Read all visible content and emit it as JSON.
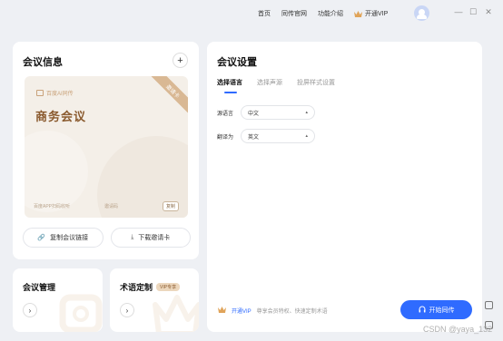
{
  "titlebar": {
    "nav": [
      "首页",
      "同传官网",
      "功能介绍"
    ],
    "vip_label": "开通VIP",
    "window_controls": [
      "—",
      "☐",
      "✕"
    ]
  },
  "left": {
    "title": "会议信息",
    "plus": "+",
    "brand": "百度AI同传",
    "meeting_name": "商务会议",
    "ribbon": "邀请卡",
    "scan_hint": "百度APP扫码收听",
    "invite_code": "邀请码",
    "copy_mini": "复制",
    "copy_link": "复制会议链接",
    "download_card": "下载邀请卡"
  },
  "cards": {
    "manage_title": "会议管理",
    "term_title": "术语定制",
    "term_badge": "VIP专享",
    "arrow": "›"
  },
  "right": {
    "title": "会议设置",
    "tabs": [
      "选择语言",
      "选择声源",
      "投屏样式设置"
    ],
    "source_label": "源语言",
    "source_value": "中文",
    "target_label": "翻译为",
    "target_value": "英文",
    "vip_open": "开通VIP",
    "vip_desc": "尊享会员特权、快速定制术语",
    "start_button": "开始同传"
  },
  "watermark": "CSDN @yaya_132",
  "colors": {
    "accent": "#2f6bff",
    "gold": "#8a5a2e"
  }
}
